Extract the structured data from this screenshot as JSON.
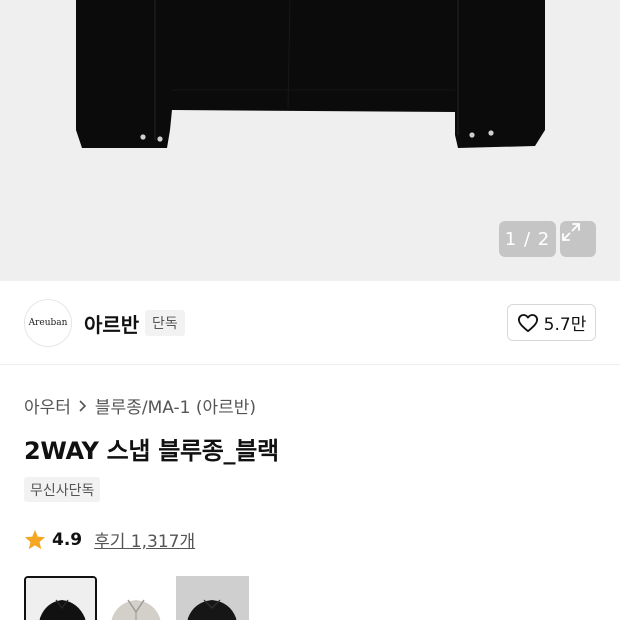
{
  "gallery": {
    "counter": "1 / 2",
    "expand_icon": "expand-icon",
    "background": "#efefef"
  },
  "brand": {
    "logo_text": "Areuban",
    "name": "아르반",
    "tag": "단독",
    "like_icon": "heart-outline-icon",
    "likes": "5.7만"
  },
  "breadcrumb": {
    "items": [
      "아우터",
      "블루종/MA-1 (아르반)"
    ]
  },
  "product": {
    "title": "2WAY 스냅 블루종_블랙",
    "store_tag": "무신사단독"
  },
  "rating": {
    "star_icon": "star-icon",
    "star_color": "#f5a623",
    "score": "4.9",
    "reviews_label": "후기 1,317개"
  },
  "thumbnails": {
    "items": [
      {
        "name": "black",
        "selected": true
      },
      {
        "name": "beige",
        "selected": false
      },
      {
        "name": "black-dark",
        "selected": false
      }
    ]
  }
}
